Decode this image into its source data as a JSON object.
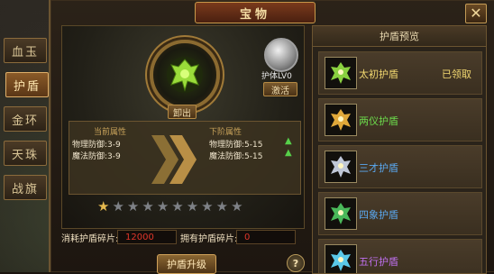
{
  "window": {
    "title": "宝物"
  },
  "side_tabs": [
    {
      "label": "血玉",
      "active": false
    },
    {
      "label": "护盾",
      "active": true
    },
    {
      "label": "金环",
      "active": false
    },
    {
      "label": "天珠",
      "active": false
    },
    {
      "label": "战旗",
      "active": false
    }
  ],
  "shield": {
    "unequip_label": "卸出",
    "body_level_label": "护体LV0",
    "activate_label": "激活"
  },
  "attributes": {
    "current_header": "当前属性",
    "next_header": "下阶属性",
    "current": [
      "物理防御:3-9",
      "魔法防御:3-9"
    ],
    "next": [
      "物理防御:5-15",
      "魔法防御:5-15"
    ]
  },
  "stars": {
    "total": 10,
    "lit": 1
  },
  "fragments": {
    "cost_label": "消耗护盾碎片:",
    "cost_value": "12000",
    "owned_label": "拥有护盾碎片:",
    "owned_value": "0"
  },
  "upgrade_label": "护盾升级",
  "help_label": "?",
  "preview": {
    "title": "护盾预览",
    "items": [
      {
        "name": "太初护盾",
        "status": "已领取",
        "color": "#f2d870",
        "icon_color": "#8ad040"
      },
      {
        "name": "两仪护盾",
        "status": "",
        "color": "#6cdb4c",
        "icon_color": "#e0a83a"
      },
      {
        "name": "三才护盾",
        "status": "",
        "color": "#5aa8f0",
        "icon_color": "#c0c8d8"
      },
      {
        "name": "四象护盾",
        "status": "",
        "color": "#5aa8f0",
        "icon_color": "#4ab85a"
      },
      {
        "name": "五行护盾",
        "status": "",
        "color": "#c070f0",
        "icon_color": "#5ac8e8"
      }
    ]
  }
}
